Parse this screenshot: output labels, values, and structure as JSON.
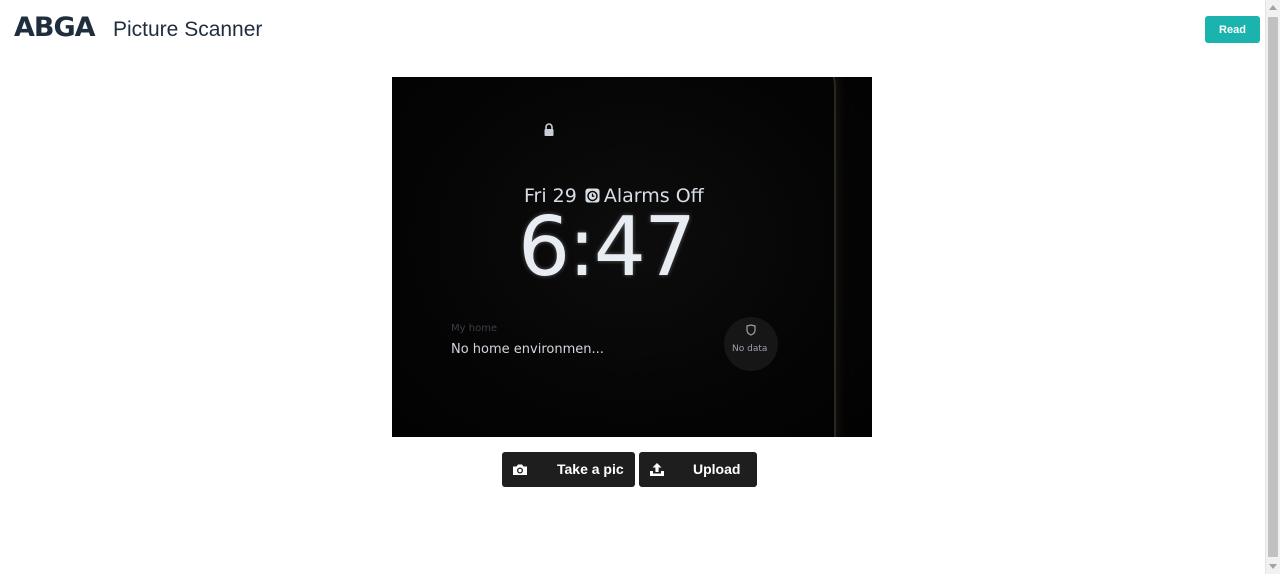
{
  "header": {
    "logo": "ABGA",
    "title": "Picture Scanner",
    "read_label": "Read"
  },
  "preview": {
    "date_text": "Fri 29",
    "alarm_text": "Alarms Off",
    "time_text": "6:47",
    "widget_title": "My home",
    "widget_text": "No home environmen...",
    "nodata_text": "No data"
  },
  "actions": {
    "take_pic_label": "Take a pic",
    "upload_label": "Upload"
  },
  "colors": {
    "accent": "#1ab3ad",
    "button_dark": "#1e1e1e",
    "text_dark": "#1f2d3d"
  },
  "icons": {
    "take_pic": "camera-icon",
    "upload": "upload-icon"
  }
}
